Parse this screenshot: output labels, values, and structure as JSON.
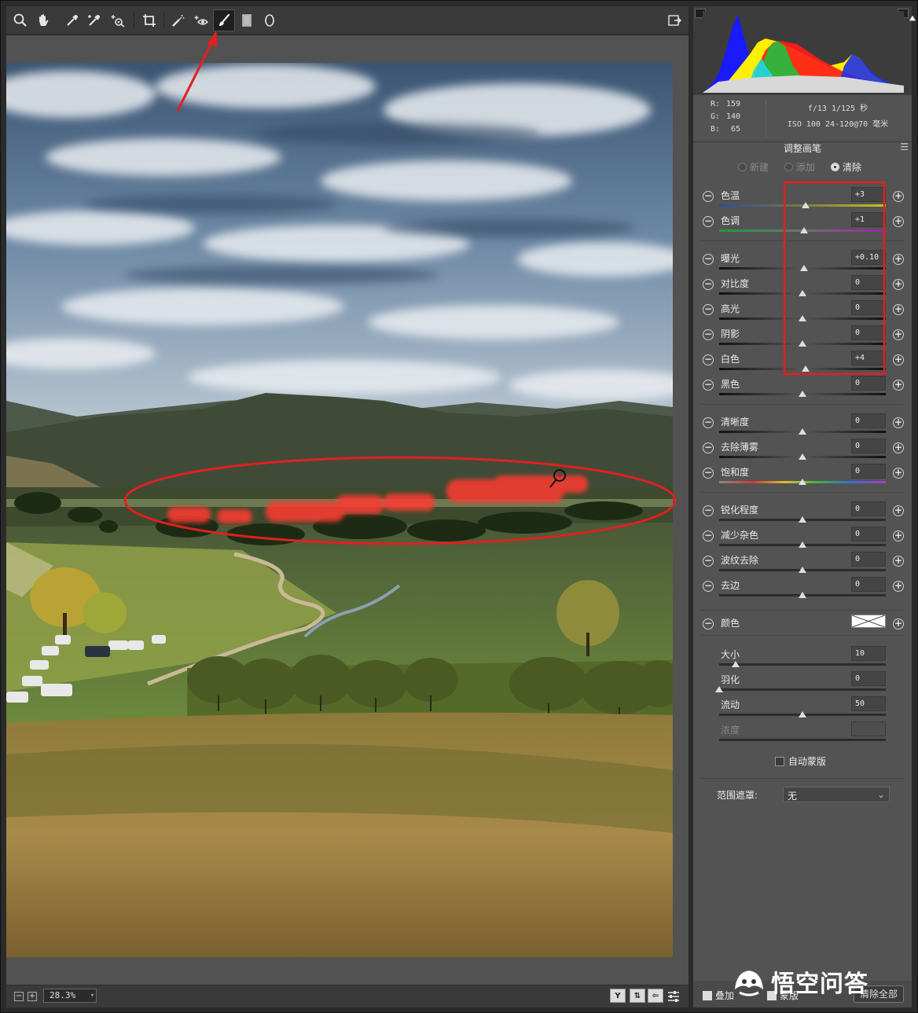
{
  "toolbar": {
    "tools": [
      "zoom-icon",
      "hand-icon",
      "white-balance-icon",
      "color-sampler-icon",
      "targeted-adjustment-icon",
      "crop-icon",
      "spot-removal-icon",
      "red-eye-icon",
      "adjustment-brush-icon",
      "graduated-filter-icon",
      "radial-filter-icon"
    ],
    "active_tool": "adjustment-brush-icon"
  },
  "statusbar": {
    "zoom": "28.3%",
    "view_buttons": [
      "Y",
      "before-after-icon",
      "swap-icon",
      "settings-icon"
    ]
  },
  "histogram": {
    "readout": {
      "r_label": "R:",
      "r": "159",
      "g_label": "G:",
      "g": "140",
      "b_label": "B:",
      "b": "65"
    },
    "exif": {
      "line1": "f/13   1/125 秒",
      "line2": "ISO 100   24-120@70 毫米"
    }
  },
  "panel": {
    "title": "调整画笔",
    "modes": [
      {
        "label": "新建",
        "selected": false
      },
      {
        "label": "添加",
        "selected": false
      },
      {
        "label": "清除",
        "selected": true
      }
    ],
    "adjustments": [
      {
        "label": "色温",
        "value": "+3",
        "level": 0.52,
        "track": "temp"
      },
      {
        "label": "色调",
        "value": "+1",
        "level": 0.51,
        "track": "tint"
      },
      {
        "label": "曝光",
        "value": "+0.10",
        "level": 0.51,
        "track": "dark"
      },
      {
        "label": "对比度",
        "value": "0",
        "level": 0.5,
        "track": "dark"
      },
      {
        "label": "高光",
        "value": "0",
        "level": 0.5,
        "track": "dark"
      },
      {
        "label": "阴影",
        "value": "0",
        "level": 0.5,
        "track": "dark"
      },
      {
        "label": "白色",
        "value": "+4",
        "level": 0.52,
        "track": "dark"
      },
      {
        "label": "黑色",
        "value": "0",
        "level": 0.5,
        "track": "dark"
      },
      {
        "label": "清晰度",
        "value": "0",
        "level": 0.5,
        "track": "dark"
      },
      {
        "label": "去除薄雾",
        "value": "0",
        "level": 0.5,
        "track": "dark"
      },
      {
        "label": "饱和度",
        "value": "0",
        "level": 0.5,
        "track": "sat"
      },
      {
        "label": "锐化程度",
        "value": "0",
        "level": 0.5,
        "track": "plain"
      },
      {
        "label": "减少杂色",
        "value": "0",
        "level": 0.5,
        "track": "plain"
      },
      {
        "label": "波纹去除",
        "value": "0",
        "level": 0.5,
        "track": "plain"
      },
      {
        "label": "去边",
        "value": "0",
        "level": 0.5,
        "track": "plain"
      }
    ],
    "color_label": "颜色",
    "brush": [
      {
        "label": "大小",
        "value": "10",
        "level": 0.1
      },
      {
        "label": "羽化",
        "value": "0",
        "level": 0.0
      },
      {
        "label": "流动",
        "value": "50",
        "level": 0.5
      },
      {
        "label": "浓度",
        "value": "",
        "level": null
      }
    ],
    "auto_mask": "自动蒙版",
    "range_mask_label": "范围遮罩:",
    "range_mask_value": "无",
    "bottom": {
      "overlay": "叠加",
      "mask": "蒙版",
      "clear_all": "清除全部"
    }
  },
  "watermark": "悟空问答",
  "colors": {
    "annotation_red": "#e02020",
    "mask_overlay": "#ff3b30"
  }
}
